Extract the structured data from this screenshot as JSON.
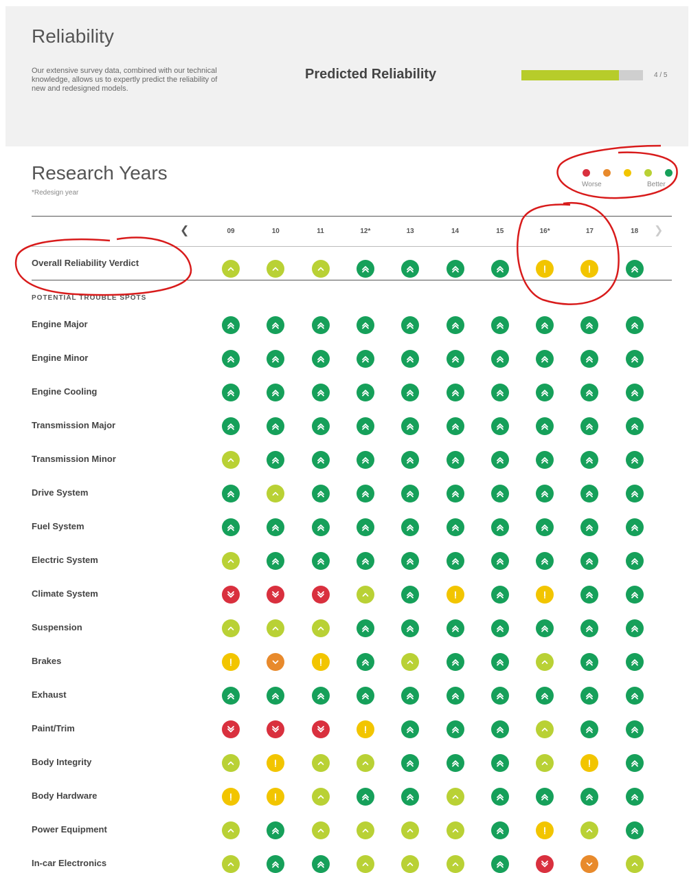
{
  "reliability": {
    "title": "Reliability",
    "description": "Our extensive survey data, combined with our technical knowledge, allows us to expertly predict the reliability of new and redesigned models.",
    "predicted_label": "Predicted Reliability",
    "score_text": "4 / 5",
    "score_fraction": 0.8,
    "bar_color": "#b7cc2a"
  },
  "research": {
    "title": "Research Years",
    "subtitle": "*Redesign year",
    "legend": {
      "worse_label": "Worse",
      "better_label": "Better",
      "colors": [
        "#d9303e",
        "#e88a2c",
        "#f2c500",
        "#b9d135",
        "#16a05a"
      ]
    },
    "years": [
      "09",
      "10",
      "11",
      "12*",
      "13",
      "14",
      "15",
      "16*",
      "17",
      "18"
    ],
    "verdict_label": "Overall Reliability Verdict",
    "verdict": [
      4,
      4,
      4,
      5,
      5,
      5,
      5,
      3,
      3,
      5
    ],
    "section_label": "POTENTIAL TROUBLE SPOTS",
    "rows": [
      {
        "label": "Engine Major",
        "ratings": [
          5,
          5,
          5,
          5,
          5,
          5,
          5,
          5,
          5,
          5
        ]
      },
      {
        "label": "Engine Minor",
        "ratings": [
          5,
          5,
          5,
          5,
          5,
          5,
          5,
          5,
          5,
          5
        ]
      },
      {
        "label": "Engine Cooling",
        "ratings": [
          5,
          5,
          5,
          5,
          5,
          5,
          5,
          5,
          5,
          5
        ]
      },
      {
        "label": "Transmission Major",
        "ratings": [
          5,
          5,
          5,
          5,
          5,
          5,
          5,
          5,
          5,
          5
        ]
      },
      {
        "label": "Transmission Minor",
        "ratings": [
          4,
          5,
          5,
          5,
          5,
          5,
          5,
          5,
          5,
          5
        ]
      },
      {
        "label": "Drive System",
        "ratings": [
          5,
          4,
          5,
          5,
          5,
          5,
          5,
          5,
          5,
          5
        ]
      },
      {
        "label": "Fuel System",
        "ratings": [
          5,
          5,
          5,
          5,
          5,
          5,
          5,
          5,
          5,
          5
        ]
      },
      {
        "label": "Electric System",
        "ratings": [
          4,
          5,
          5,
          5,
          5,
          5,
          5,
          5,
          5,
          5
        ]
      },
      {
        "label": "Climate System",
        "ratings": [
          1,
          1,
          1,
          4,
          5,
          3,
          5,
          3,
          5,
          5
        ]
      },
      {
        "label": "Suspension",
        "ratings": [
          4,
          4,
          4,
          5,
          5,
          5,
          5,
          5,
          5,
          5
        ]
      },
      {
        "label": "Brakes",
        "ratings": [
          3,
          2,
          3,
          5,
          4,
          5,
          5,
          4,
          5,
          5
        ]
      },
      {
        "label": "Exhaust",
        "ratings": [
          5,
          5,
          5,
          5,
          5,
          5,
          5,
          5,
          5,
          5
        ]
      },
      {
        "label": "Paint/Trim",
        "ratings": [
          1,
          1,
          1,
          3,
          5,
          5,
          5,
          4,
          5,
          5
        ]
      },
      {
        "label": "Body Integrity",
        "ratings": [
          4,
          3,
          4,
          4,
          5,
          5,
          5,
          4,
          3,
          5
        ]
      },
      {
        "label": "Body Hardware",
        "ratings": [
          3,
          3,
          4,
          5,
          5,
          4,
          5,
          5,
          5,
          5
        ]
      },
      {
        "label": "Power Equipment",
        "ratings": [
          4,
          5,
          4,
          4,
          4,
          4,
          5,
          3,
          4,
          5
        ]
      },
      {
        "label": "In-car Electronics",
        "ratings": [
          4,
          5,
          5,
          4,
          4,
          4,
          5,
          1,
          2,
          4
        ]
      }
    ]
  }
}
